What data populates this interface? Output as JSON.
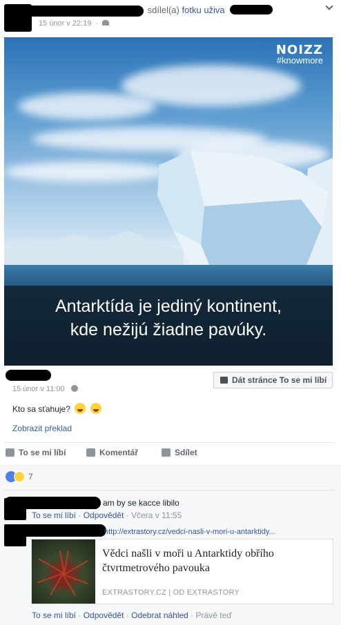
{
  "header": {
    "shared_text": "sdílel(a)",
    "photo_link": "fotku",
    "user_text": "uživa",
    "time": "15 únor v 22:19",
    "privacy_icon": "friends-icon"
  },
  "photo": {
    "brand": "NOIZZ",
    "hashtag": "#knowmore",
    "caption_line1": "Antarktída je jediný kontinent,",
    "caption_line2": "kde nežijú žiadne pavúky."
  },
  "original_post": {
    "time": "15 únor v 11:00",
    "privacy_icon": "globe-icon",
    "like_page_button": "Dát stránce To se mi líbí",
    "text": "Kto sa sťahuje?",
    "translate": "Zobrazit překlad"
  },
  "actions": {
    "like": "To se mi líbí",
    "comment": "Komentář",
    "share": "Sdílet"
  },
  "reactions": {
    "count": "7",
    "icons": [
      "like-icon",
      "haha-icon"
    ]
  },
  "comments": [
    {
      "text": "am by se kacce libilo",
      "like": "To se mi líbí",
      "reply": "Odpovědět",
      "time": "Včera v 11:55"
    },
    {
      "url": "http://extrastory.cz/vedci-nasli-v-mori-u-antarktidy...",
      "preview_title": "Vědci našli v moři u Antarktidy obřího čtvrtmetrového pavouka",
      "preview_source": "EXTRASTORY.CZ | OD EXTRASTORY",
      "like": "To se mi líbí",
      "reply": "Odpovědět",
      "remove_preview": "Odebrat náhled",
      "time": "Právě teď"
    }
  ],
  "colors": {
    "link": "#365899",
    "muted": "#90949c",
    "text": "#1d2129",
    "like_blue": "#4f7fe8"
  }
}
